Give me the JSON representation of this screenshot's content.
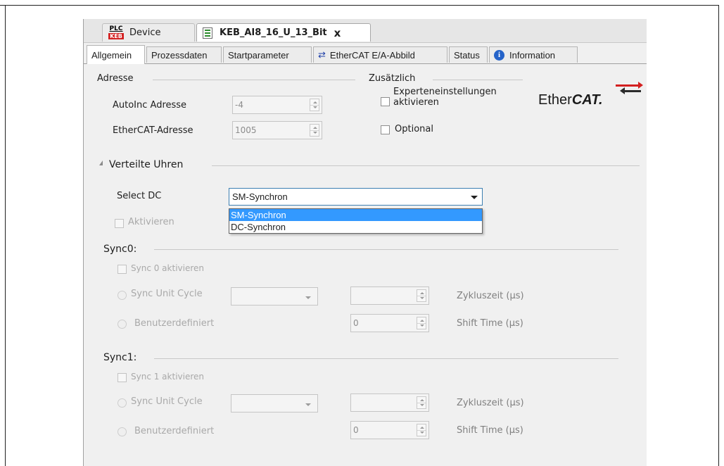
{
  "doc_tabs": {
    "device_icon_top": "PLC",
    "device_icon_bottom": "KEB",
    "device_label": "Device",
    "active_label": "KEB_AI8_16_U_13_Bit",
    "close_glyph": "x"
  },
  "sub_tabs": [
    "Allgemein",
    "Prozessdaten",
    "Startparameter",
    "EtherCAT E/A-Abbild",
    "Status",
    "Information"
  ],
  "icons": {
    "ethercat_tab": "bidirectional-arrows-icon",
    "information_tab": "info-icon"
  },
  "address": {
    "title": "Adresse",
    "autoinc_label": "AutoInc Adresse",
    "autoinc_value": "-4",
    "ethercat_label": "EtherCAT-Adresse",
    "ethercat_value": "1005"
  },
  "additional": {
    "title": "Zusätzlich",
    "expert_label_1": "Experteneinstellungen",
    "expert_label_2": "aktivieren",
    "optional_label": "Optional"
  },
  "logo": {
    "text_plain": "Ether",
    "text_bold": "CAT."
  },
  "dc": {
    "title": "Verteilte Uhren",
    "select_label": "Select DC",
    "selected": "SM-Synchron",
    "options": [
      "SM-Synchron",
      "DC-Synchron"
    ],
    "activate_label": "Aktivieren"
  },
  "sync0": {
    "title": "Sync0:",
    "activate_label": "Sync 0 aktivieren",
    "unit_cycle_label": "Sync Unit Cycle",
    "user_defined_label": "Benutzerdefiniert",
    "cycle_time_label": "Zykluszeit (µs)",
    "shift_time_label": "Shift Time (µs)",
    "shift_value": "0"
  },
  "sync1": {
    "title": "Sync1:",
    "activate_label": "Sync 1 aktivieren",
    "unit_cycle_label": "Sync Unit Cycle",
    "user_defined_label": "Benutzerdefiniert",
    "cycle_time_label": "Zykluszeit (µs)",
    "shift_time_label": "Shift Time (µs)",
    "shift_value": "0"
  }
}
